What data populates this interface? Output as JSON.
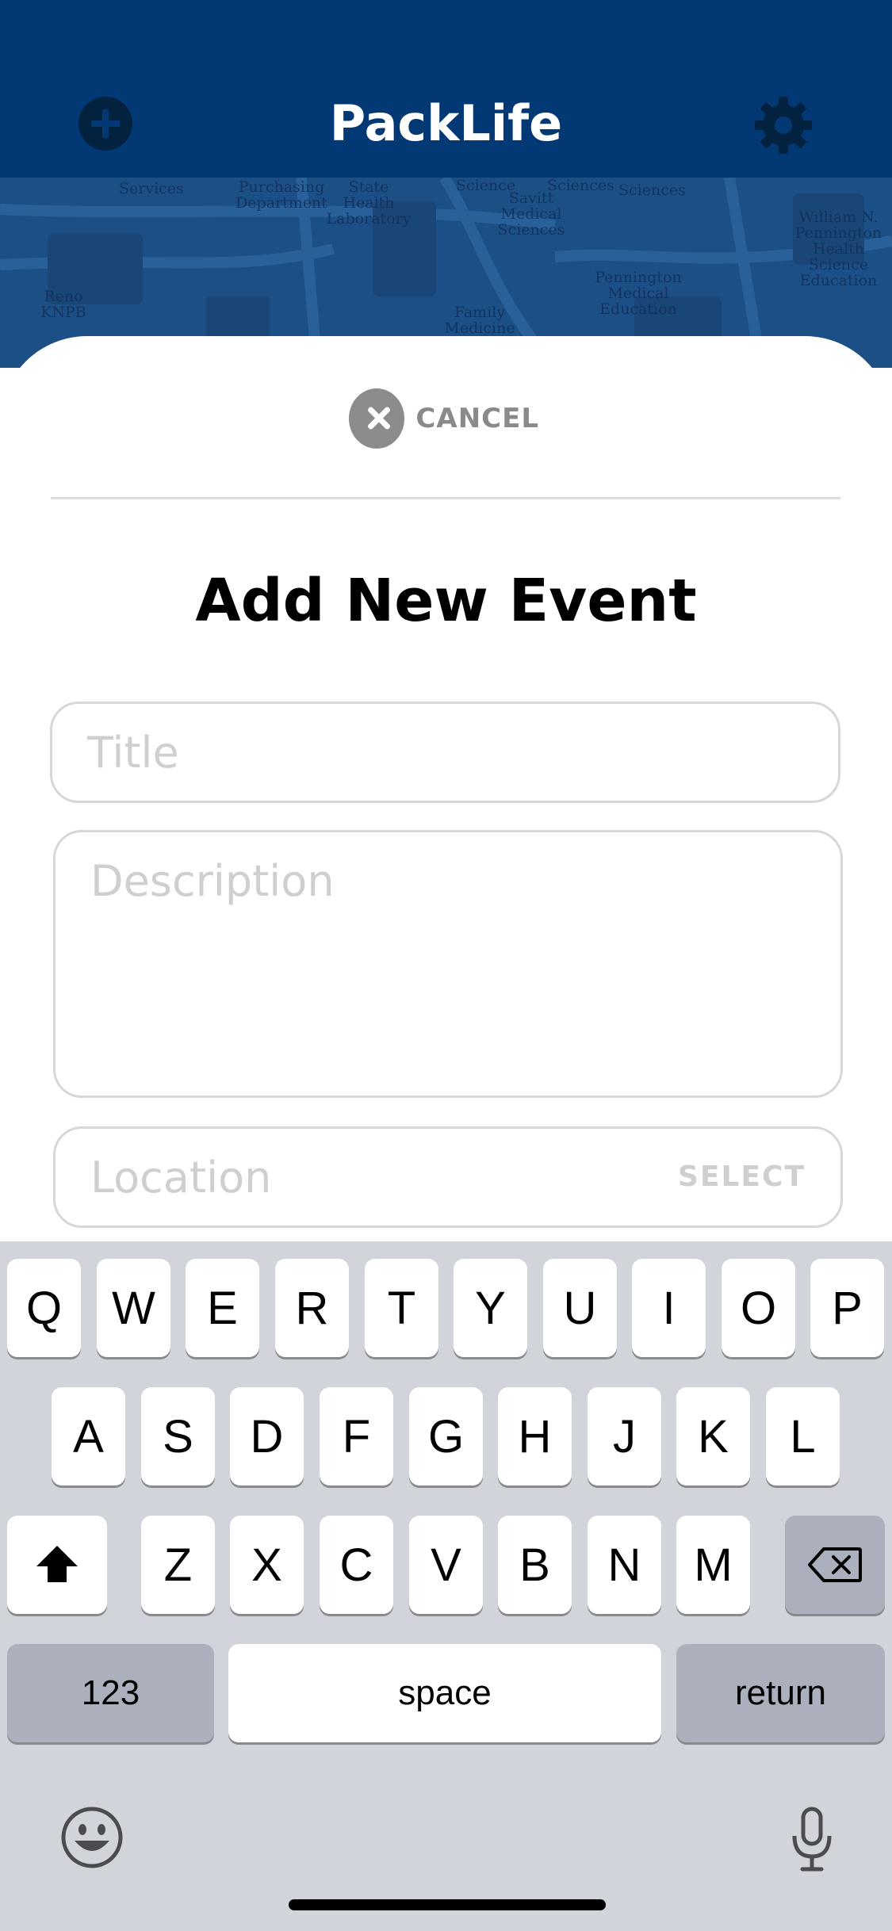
{
  "header": {
    "title": "PackLife",
    "add_icon": "plus-circle-icon",
    "settings_icon": "gear-icon",
    "background_color": "#023975"
  },
  "map": {
    "labels": [
      "Purchasing Department",
      "State Health Laboratory",
      "Science",
      "Savitt Medical Sciences",
      "Sciences",
      "Sciences",
      "William N. Pennington Health Science Education",
      "Pennington Medical Education",
      "Family Medicine",
      "Reno KNPB",
      "Services"
    ]
  },
  "sheet": {
    "cancel_label": "CANCEL",
    "cancel_icon": "close-icon",
    "title": "Add New Event",
    "title_placeholder": "Title",
    "description_placeholder": "Description",
    "location_placeholder": "Location",
    "location_select": "SELECT"
  },
  "keyboard": {
    "row1": [
      "Q",
      "W",
      "E",
      "R",
      "T",
      "Y",
      "U",
      "I",
      "O",
      "P"
    ],
    "row2": [
      "A",
      "S",
      "D",
      "F",
      "G",
      "H",
      "J",
      "K",
      "L"
    ],
    "row3": [
      "Z",
      "X",
      "C",
      "V",
      "B",
      "N",
      "M"
    ],
    "shift_icon": "shift-icon",
    "backspace_icon": "backspace-icon",
    "numbers_label": "123",
    "space_label": "space",
    "return_label": "return",
    "emoji_icon": "emoji-icon",
    "mic_icon": "microphone-icon"
  }
}
